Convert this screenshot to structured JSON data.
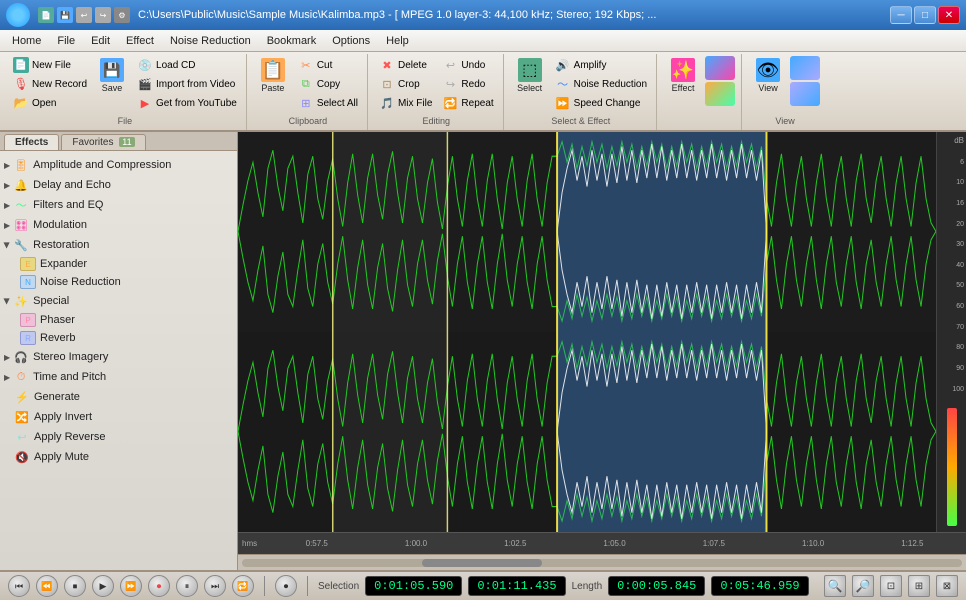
{
  "titlebar": {
    "title": "C:\\Users\\Public\\Music\\Sample Music\\Kalimba.mp3 - [ MPEG 1.0 layer-3: 44,100 kHz; Stereo; 192 Kbps; ...",
    "minimize": "─",
    "maximize": "□",
    "close": "✕"
  },
  "menubar": {
    "items": [
      "Home",
      "File",
      "Edit",
      "Effect",
      "Noise Reduction",
      "Bookmark",
      "Options",
      "Help"
    ]
  },
  "ribbon": {
    "file_group": {
      "label": "File",
      "new_file": "New File",
      "new_record": "New Record",
      "open": "Open",
      "load_cd": "Load CD",
      "import_video": "Import from Video",
      "get_youtube": "Get from YouTube",
      "save": "Save"
    },
    "clipboard_group": {
      "label": "Clipboard",
      "paste": "Paste",
      "cut": "Cut",
      "copy": "Copy",
      "select_all": "Select All"
    },
    "editing_group": {
      "label": "Editing",
      "delete": "Delete",
      "crop": "Crop",
      "mix_file": "Mix File",
      "undo": "Undo",
      "redo": "Redo",
      "repeat": "Repeat"
    },
    "select_effect_group": {
      "label": "Select & Effect",
      "select": "Select",
      "amplify": "Amplify",
      "noise_reduction": "Noise Reduction",
      "speed_change": "Speed Change"
    },
    "effect_group": {
      "label": "",
      "effect": "Effect"
    },
    "view_group": {
      "label": "View",
      "view": "View"
    }
  },
  "left_panel": {
    "tabs": [
      "Effects",
      "Favorites"
    ],
    "fav_count": "11",
    "effects": [
      {
        "id": "amplitude",
        "label": "Amplitude and Compression",
        "level": 0,
        "has_children": true,
        "expanded": false,
        "icon": "amp"
      },
      {
        "id": "delay",
        "label": "Delay and Echo",
        "level": 0,
        "has_children": true,
        "expanded": false,
        "icon": "delay"
      },
      {
        "id": "filters",
        "label": "Filters and EQ",
        "level": 0,
        "has_children": true,
        "expanded": false,
        "icon": "filter"
      },
      {
        "id": "modulation",
        "label": "Modulation",
        "level": 0,
        "has_children": true,
        "expanded": false,
        "icon": "mod"
      },
      {
        "id": "restoration",
        "label": "Restoration",
        "level": 0,
        "has_children": true,
        "expanded": true,
        "icon": "restore"
      },
      {
        "id": "expander",
        "label": "Expander",
        "level": 1,
        "has_children": false,
        "icon": "expander"
      },
      {
        "id": "noisered",
        "label": "Noise Reduction",
        "level": 1,
        "has_children": false,
        "icon": "noisered"
      },
      {
        "id": "special",
        "label": "Special",
        "level": 0,
        "has_children": true,
        "expanded": true,
        "icon": "special"
      },
      {
        "id": "phaser",
        "label": "Phaser",
        "level": 1,
        "has_children": false,
        "icon": "phaser"
      },
      {
        "id": "reverb",
        "label": "Reverb",
        "level": 1,
        "has_children": false,
        "icon": "reverb"
      },
      {
        "id": "stereo",
        "label": "Stereo Imagery",
        "level": 0,
        "has_children": true,
        "expanded": false,
        "icon": "stereo"
      },
      {
        "id": "timeandpitch",
        "label": "Time and Pitch",
        "level": 0,
        "has_children": true,
        "expanded": false,
        "icon": "time"
      },
      {
        "id": "generate",
        "label": "Generate",
        "level": 0,
        "has_children": false,
        "icon": "gen"
      },
      {
        "id": "applyinvert",
        "label": "Apply Invert",
        "level": 0,
        "has_children": false,
        "icon": "invert"
      },
      {
        "id": "applyreverse",
        "label": "Apply Reverse",
        "level": 0,
        "has_children": false,
        "icon": "reverse"
      },
      {
        "id": "applymute",
        "label": "Apply Mute",
        "level": 0,
        "has_children": false,
        "icon": "mute"
      }
    ]
  },
  "waveform": {
    "selection_start": "0:01:05.590",
    "selection_end": "0:01:11.435",
    "length": "0:00:05.845",
    "total_length": "0:05:46.959",
    "timeline_marks": [
      "hms",
      "0:57.5",
      "1:00.0",
      "1:02.5",
      "1:05.0",
      "1:07.5",
      "1:10.0",
      "1:12.5"
    ],
    "db_marks": [
      "dB",
      "6",
      "10",
      "16",
      "20",
      "30",
      "40",
      "50",
      "60",
      "70",
      "80",
      "90",
      "100"
    ]
  },
  "transport": {
    "buttons": [
      "⏮",
      "⏪",
      "⏹",
      "▶",
      "⏩",
      "⏺",
      "⏸",
      "⏭",
      "⏺"
    ],
    "selection_label": "Selection",
    "length_label": "Length"
  },
  "statusbar": {
    "selection_start": "0:01:05.590",
    "selection_end": "0:01:11.435",
    "length": "0:00:05.845",
    "total": "0:05:46.959"
  }
}
